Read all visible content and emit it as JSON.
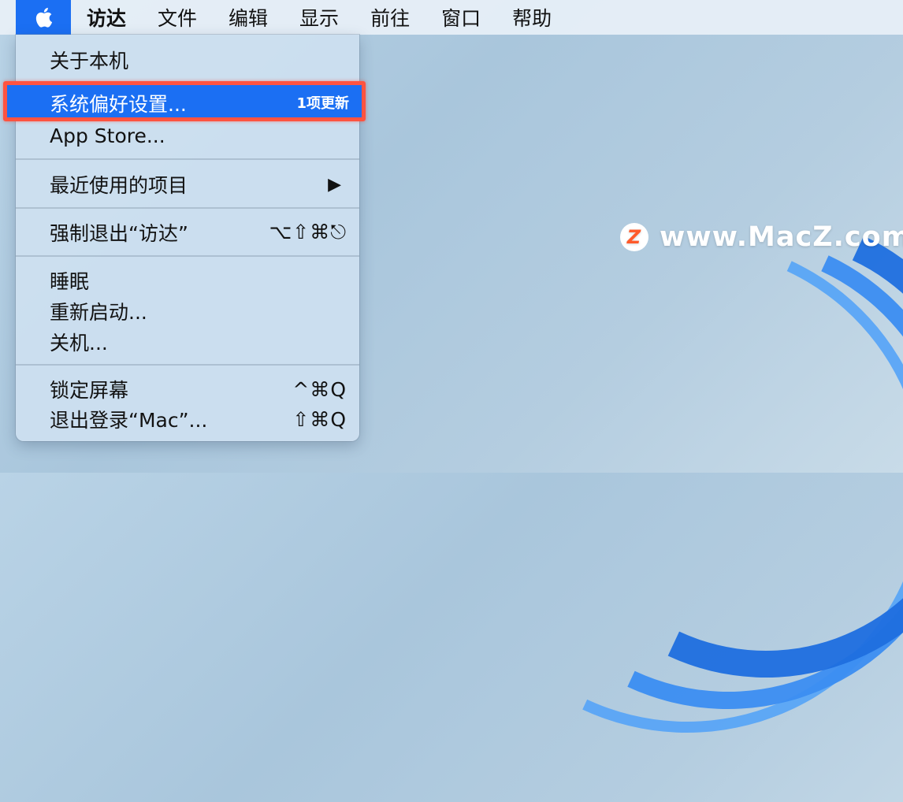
{
  "menubar": {
    "apple_icon": "apple-logo-icon",
    "items": [
      "访达",
      "文件",
      "编辑",
      "显示",
      "前往",
      "窗口",
      "帮助"
    ]
  },
  "apple_menu": {
    "about": "关于本机",
    "system_prefs": "系统偏好设置...",
    "system_prefs_badge": "1项更新",
    "app_store": "App Store...",
    "recent_items": "最近使用的项目",
    "recent_items_arrow": "▶",
    "force_quit": "强制退出“访达”",
    "force_quit_shortcut": "⌥⇧⌘⎋",
    "sleep": "睡眠",
    "restart": "重新启动...",
    "shutdown": "关机...",
    "lock_screen": "锁定屏幕",
    "lock_screen_shortcut": "^⌘Q",
    "logout": "退出登录“Mac”...",
    "logout_shortcut": "⇧⌘Q"
  },
  "watermark": {
    "logo_letter": "Z",
    "text": "www.MacZ.com"
  },
  "colors": {
    "highlight": "#1b6ff3",
    "callout_border": "#ff5340"
  }
}
